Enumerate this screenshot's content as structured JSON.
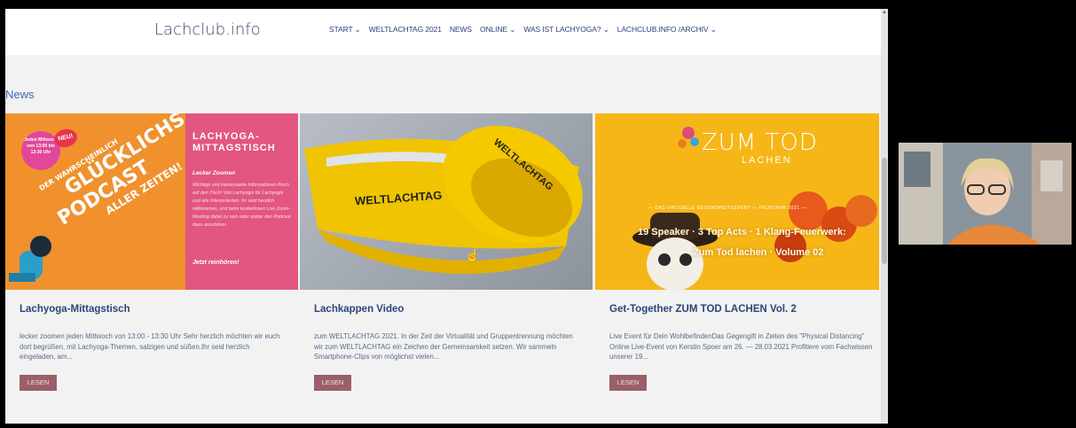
{
  "site": {
    "logo": "Lachclub.info"
  },
  "nav": {
    "items": [
      "START ⌄",
      "WELTLACHTAG 2021",
      "NEWS",
      "ONLINE ⌄",
      "WAS IST LACHYOGA? ⌄",
      "LACHCLUB.INFO /ARCHIV ⌄"
    ]
  },
  "section": {
    "title": "News"
  },
  "cards": [
    {
      "title": "Lachyoga-Mittagstisch",
      "excerpt": "lecker zoomen jeden Mittwoch von 13:00 - 13:30 Uhr Sehr herzlich möchten wir euch dort begrüßen, mit Lachyoga-Themen, salzigen und süßen.Ihr seid herzlich eingeladen, am...",
      "button": "LESEN",
      "image": {
        "badge": "Jeden Mittwoch von 13:00 bis 13:30 Uhr",
        "new": "NEU!",
        "lines": [
          "DER WAHRSCHEINLICH",
          "GLÜCKLICHSTE",
          "PODCAST",
          "ALLER ZEITEN!"
        ],
        "right_title": "LACHYOGA-MITTAGSTISCH",
        "right_sub": "Lecker Zoomen",
        "right_body": "Wichtige und interessante Informationen frisch auf den Tisch! Von Lachyogis für Lachyogis und alle Interessierten. Ihr seid herzlich willkommen, erst beim kostenlosen Live Zoom-Meeting dabei zu sein oder später den Podcast dazu anzuhören.",
        "right_cta": "Jetzt reinhören!"
      }
    },
    {
      "title": "Lachkappen Video",
      "excerpt": "zum WELTLACHTAG 2021. In der Zeit der Virtualität und Gruppentrennung möchten wir zum WELTLACHTAG ein Zeichen der Gemeinsamkeit setzen. Wir sammeln Smartphone-Clips von möglichst vielen...",
      "button": "LESEN",
      "image": {
        "cap1": "WELTLACHTAG",
        "cap2": "WELTLACHTAG"
      }
    },
    {
      "title": "Get-Together ZUM TOD LACHEN Vol. 2",
      "excerpt": "Live Event für Dein WohlbefindenDas Gegengift in Zeiten des \"Physical Distancing\" Online Live-Event von Kerstin Spoer am 26. — 28.03.2021 Profitiere vom Fachwissen unserer 19...",
      "button": "LESEN",
      "image": {
        "logo1": "ZUM TOD",
        "logo2": "LACHEN",
        "tagline": "— DAS VIRTUELLE GESUNDHEITSEVENT — FRÜHJAHR 2021 —",
        "headline": "19 Speaker · 3 Top Acts · 1 Klang-Feuerwerk:",
        "subline": "Zum Tod lachen · Volume 02"
      }
    }
  ],
  "colors": {
    "accent_pink": "#e2567f",
    "orange": "#f0912d",
    "yellow": "#f6b617",
    "button": "#9a5f68"
  }
}
